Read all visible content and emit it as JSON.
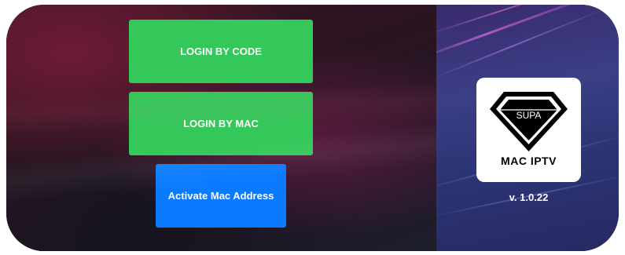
{
  "buttons": {
    "login_by_code": "LOGIN BY CODE",
    "login_by_mac": "LOGIN BY MAC",
    "activate_mac": "Activate Mac Address"
  },
  "brand": {
    "gem_label": "SUPA",
    "app_name": "MAC IPTV",
    "version": "v. 1.0.22"
  },
  "colors": {
    "primary_green": "#34c759",
    "primary_blue": "#0a7bff"
  },
  "icons": {
    "logo": "diamond-logo-icon"
  }
}
